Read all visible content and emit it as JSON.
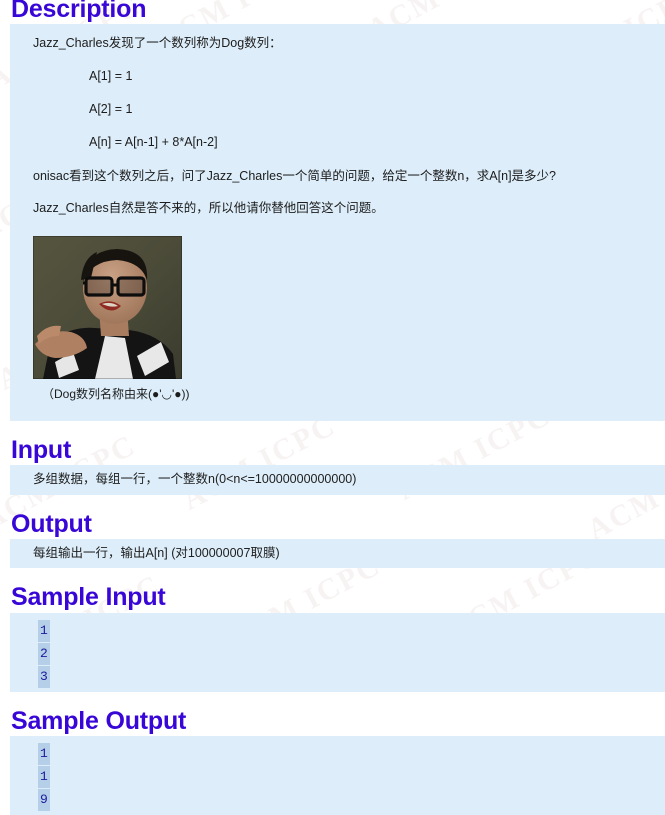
{
  "colors": {
    "heading": "#3806d6",
    "block_background": "#ddeefa",
    "selection_highlight": "#b6cfe8",
    "selection_text": "#1a1a9e",
    "body_text": "#1c1c1c",
    "page_background": "#ffffff"
  },
  "watermark": {
    "text": "ACM ICPC"
  },
  "sections": {
    "description": {
      "heading": "Description",
      "intro": "Jazz_Charles发现了一个数列称为Dog数列：",
      "formulas": [
        "A[1] = 1",
        "A[2] = 1",
        "A[n] = A[n-1] + 8*A[n-2]"
      ],
      "paragraph_1": "onisac看到这个数列之后，问了Jazz_Charles一个简单的问题，给定一个整数n，求A[n]是多少?",
      "paragraph_2": "Jazz_Charles自然是答不来的，所以他请你替他回答这个问题。",
      "image_alt": "photo-of-person-with-glasses",
      "image_caption": "（Dog数列名称由来(●'◡'●))"
    },
    "input": {
      "heading": "Input",
      "text": "多组数据，每组一行，一个整数n(0<n<=10000000000000)"
    },
    "output": {
      "heading": "Output",
      "text": "每组输出一行，输出A[n] (对100000007取膜)"
    },
    "sample_input": {
      "heading": "Sample Input",
      "lines": [
        "1",
        "2",
        "3"
      ]
    },
    "sample_output": {
      "heading": "Sample Output",
      "lines": [
        "1",
        "1",
        "9"
      ]
    }
  }
}
